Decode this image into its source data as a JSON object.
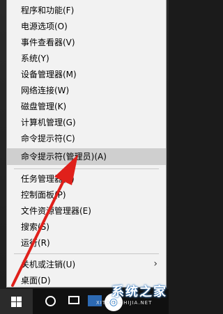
{
  "menu": {
    "items": [
      {
        "label": "程序和功能(F)"
      },
      {
        "label": "电源选项(O)"
      },
      {
        "label": "事件查看器(V)"
      },
      {
        "label": "系统(Y)"
      },
      {
        "label": "设备管理器(M)"
      },
      {
        "label": "网络连接(W)"
      },
      {
        "label": "磁盘管理(K)"
      },
      {
        "label": "计算机管理(G)"
      },
      {
        "label": "命令提示符(C)"
      },
      {
        "label": "命令提示符(管理员)(A)"
      },
      {
        "label": "任务管理器(T)"
      },
      {
        "label": "控制面板(P)"
      },
      {
        "label": "文件资源管理器(E)"
      },
      {
        "label": "搜索(S)"
      },
      {
        "label": "运行(R)"
      },
      {
        "label": "关机或注销(U)"
      },
      {
        "label": "桌面(D)"
      }
    ],
    "highlighted_index": 9,
    "submenu_chevron": "›"
  },
  "watermark": {
    "title": "系统之家",
    "url": "XITONGZHIJIA.NET",
    "logo_glyph": "◎"
  },
  "annotation": {
    "arrow_color": "#e0201b"
  },
  "icons": [
    "windows-logo-icon",
    "search-icon",
    "task-view-icon",
    "taskbar-app-icon"
  ]
}
